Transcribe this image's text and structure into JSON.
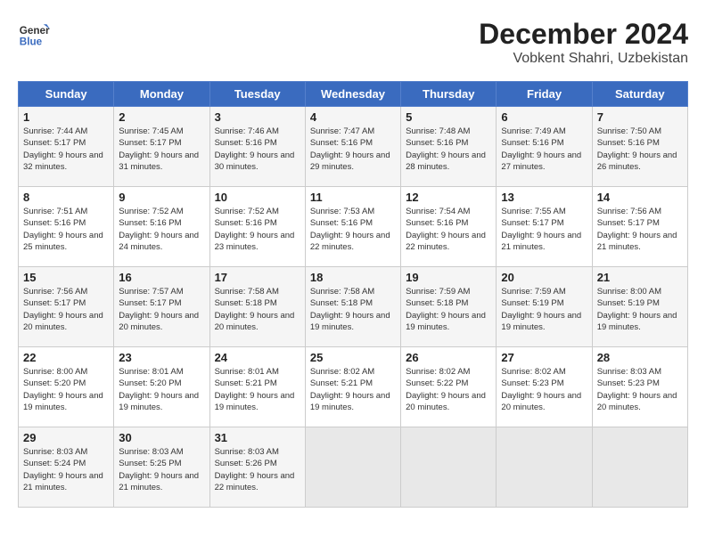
{
  "header": {
    "logo_line1": "General",
    "logo_line2": "Blue",
    "month": "December 2024",
    "location": "Vobkent Shahri, Uzbekistan"
  },
  "weekdays": [
    "Sunday",
    "Monday",
    "Tuesday",
    "Wednesday",
    "Thursday",
    "Friday",
    "Saturday"
  ],
  "weeks": [
    [
      {
        "day": "1",
        "sunrise": "7:44 AM",
        "sunset": "5:17 PM",
        "daylight": "9 hours and 32 minutes."
      },
      {
        "day": "2",
        "sunrise": "7:45 AM",
        "sunset": "5:17 PM",
        "daylight": "9 hours and 31 minutes."
      },
      {
        "day": "3",
        "sunrise": "7:46 AM",
        "sunset": "5:16 PM",
        "daylight": "9 hours and 30 minutes."
      },
      {
        "day": "4",
        "sunrise": "7:47 AM",
        "sunset": "5:16 PM",
        "daylight": "9 hours and 29 minutes."
      },
      {
        "day": "5",
        "sunrise": "7:48 AM",
        "sunset": "5:16 PM",
        "daylight": "9 hours and 28 minutes."
      },
      {
        "day": "6",
        "sunrise": "7:49 AM",
        "sunset": "5:16 PM",
        "daylight": "9 hours and 27 minutes."
      },
      {
        "day": "7",
        "sunrise": "7:50 AM",
        "sunset": "5:16 PM",
        "daylight": "9 hours and 26 minutes."
      }
    ],
    [
      {
        "day": "8",
        "sunrise": "7:51 AM",
        "sunset": "5:16 PM",
        "daylight": "9 hours and 25 minutes."
      },
      {
        "day": "9",
        "sunrise": "7:52 AM",
        "sunset": "5:16 PM",
        "daylight": "9 hours and 24 minutes."
      },
      {
        "day": "10",
        "sunrise": "7:52 AM",
        "sunset": "5:16 PM",
        "daylight": "9 hours and 23 minutes."
      },
      {
        "day": "11",
        "sunrise": "7:53 AM",
        "sunset": "5:16 PM",
        "daylight": "9 hours and 22 minutes."
      },
      {
        "day": "12",
        "sunrise": "7:54 AM",
        "sunset": "5:16 PM",
        "daylight": "9 hours and 22 minutes."
      },
      {
        "day": "13",
        "sunrise": "7:55 AM",
        "sunset": "5:17 PM",
        "daylight": "9 hours and 21 minutes."
      },
      {
        "day": "14",
        "sunrise": "7:56 AM",
        "sunset": "5:17 PM",
        "daylight": "9 hours and 21 minutes."
      }
    ],
    [
      {
        "day": "15",
        "sunrise": "7:56 AM",
        "sunset": "5:17 PM",
        "daylight": "9 hours and 20 minutes."
      },
      {
        "day": "16",
        "sunrise": "7:57 AM",
        "sunset": "5:17 PM",
        "daylight": "9 hours and 20 minutes."
      },
      {
        "day": "17",
        "sunrise": "7:58 AM",
        "sunset": "5:18 PM",
        "daylight": "9 hours and 20 minutes."
      },
      {
        "day": "18",
        "sunrise": "7:58 AM",
        "sunset": "5:18 PM",
        "daylight": "9 hours and 19 minutes."
      },
      {
        "day": "19",
        "sunrise": "7:59 AM",
        "sunset": "5:18 PM",
        "daylight": "9 hours and 19 minutes."
      },
      {
        "day": "20",
        "sunrise": "7:59 AM",
        "sunset": "5:19 PM",
        "daylight": "9 hours and 19 minutes."
      },
      {
        "day": "21",
        "sunrise": "8:00 AM",
        "sunset": "5:19 PM",
        "daylight": "9 hours and 19 minutes."
      }
    ],
    [
      {
        "day": "22",
        "sunrise": "8:00 AM",
        "sunset": "5:20 PM",
        "daylight": "9 hours and 19 minutes."
      },
      {
        "day": "23",
        "sunrise": "8:01 AM",
        "sunset": "5:20 PM",
        "daylight": "9 hours and 19 minutes."
      },
      {
        "day": "24",
        "sunrise": "8:01 AM",
        "sunset": "5:21 PM",
        "daylight": "9 hours and 19 minutes."
      },
      {
        "day": "25",
        "sunrise": "8:02 AM",
        "sunset": "5:21 PM",
        "daylight": "9 hours and 19 minutes."
      },
      {
        "day": "26",
        "sunrise": "8:02 AM",
        "sunset": "5:22 PM",
        "daylight": "9 hours and 20 minutes."
      },
      {
        "day": "27",
        "sunrise": "8:02 AM",
        "sunset": "5:23 PM",
        "daylight": "9 hours and 20 minutes."
      },
      {
        "day": "28",
        "sunrise": "8:03 AM",
        "sunset": "5:23 PM",
        "daylight": "9 hours and 20 minutes."
      }
    ],
    [
      {
        "day": "29",
        "sunrise": "8:03 AM",
        "sunset": "5:24 PM",
        "daylight": "9 hours and 21 minutes."
      },
      {
        "day": "30",
        "sunrise": "8:03 AM",
        "sunset": "5:25 PM",
        "daylight": "9 hours and 21 minutes."
      },
      {
        "day": "31",
        "sunrise": "8:03 AM",
        "sunset": "5:26 PM",
        "daylight": "9 hours and 22 minutes."
      },
      null,
      null,
      null,
      null
    ]
  ]
}
